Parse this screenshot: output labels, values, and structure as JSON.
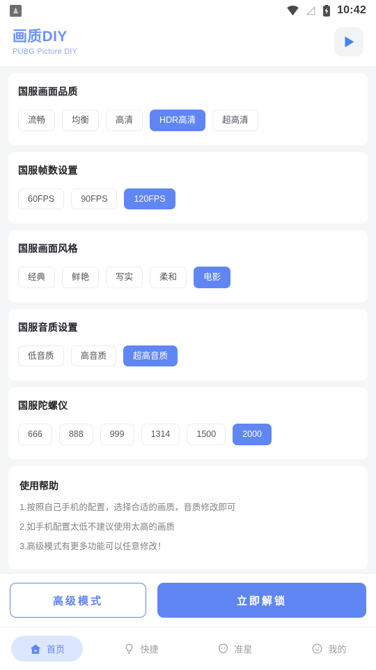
{
  "status_bar": {
    "app_badge_icon": "android-app-icon",
    "wifi_icon": "wifi-icon",
    "signal_icon": "no-signal-icon",
    "battery_icon": "battery-charging-icon",
    "time": "10:42"
  },
  "header": {
    "title": "画质DIY",
    "subtitle": "PUBG Picture DIY",
    "play_button_icon": "play-icon"
  },
  "sections": [
    {
      "title": "国服画面品质",
      "options": [
        "流畅",
        "均衡",
        "高清",
        "HDR高清",
        "超高清"
      ],
      "selected": "HDR高清"
    },
    {
      "title": "国服帧数设置",
      "options": [
        "60FPS",
        "90FPS",
        "120FPS"
      ],
      "selected": "120FPS"
    },
    {
      "title": "国服画面风格",
      "options": [
        "经典",
        "鲜艳",
        "写实",
        "柔和",
        "电影"
      ],
      "selected": "电影"
    },
    {
      "title": "国服音质设置",
      "options": [
        "低音质",
        "高音质",
        "超高音质"
      ],
      "selected": "超高音质"
    },
    {
      "title": "国服陀螺仪",
      "options": [
        "666",
        "888",
        "999",
        "1314",
        "1500",
        "2000"
      ],
      "selected": "2000"
    }
  ],
  "help": {
    "title": "使用帮助",
    "lines": [
      "1.按照自己手机的配置，选择合适的画质，音质修改即可",
      "2.如手机配置太低不建议使用太高的画质",
      "3.高级模式有更多功能可以任意修改！"
    ]
  },
  "actions": {
    "advanced_label": "高级模式",
    "unlock_label": "立即解锁"
  },
  "bottom_nav": [
    {
      "label": "首页",
      "icon": "home-icon",
      "active": true
    },
    {
      "label": "快捷",
      "icon": "lightbulb-icon",
      "active": false
    },
    {
      "label": "准星",
      "icon": "alien-crosshair-icon",
      "active": false
    },
    {
      "label": "我的",
      "icon": "profile-face-icon",
      "active": false
    }
  ],
  "colors": {
    "accent": "#5f86f2",
    "brand_title": "#6b92f5",
    "brand_sub": "#8aa9f7",
    "page_bg": "#f5f6f8",
    "card_bg": "#ffffff",
    "nav_active_pill": "#dce7fd",
    "nav_inactive": "#9b9da3"
  }
}
